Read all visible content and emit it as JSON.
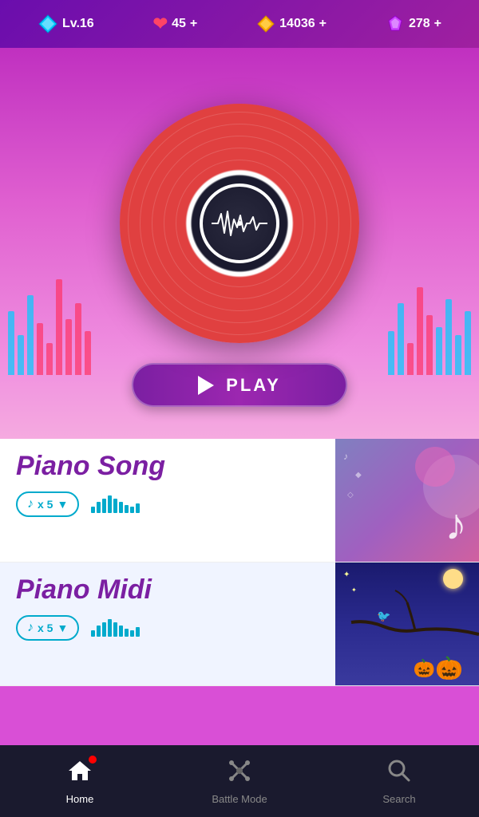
{
  "topbar": {
    "level_label": "Lv.16",
    "hearts": "45",
    "coins": "14036",
    "gems": "278",
    "plus": "+"
  },
  "hero": {
    "play_label": "PLAY"
  },
  "cards": [
    {
      "title": "Piano Song",
      "note_count": "x 5",
      "thumb_type": "song"
    },
    {
      "title": "Piano Midi",
      "note_count": "x 5",
      "thumb_type": "midi"
    }
  ],
  "nav": {
    "home_label": "Home",
    "battle_label": "Battle Mode",
    "search_label": "Search"
  },
  "colors": {
    "purple_dark": "#7b1fa2",
    "cyan": "#00aacc",
    "nav_bg": "#1a1a2e"
  }
}
